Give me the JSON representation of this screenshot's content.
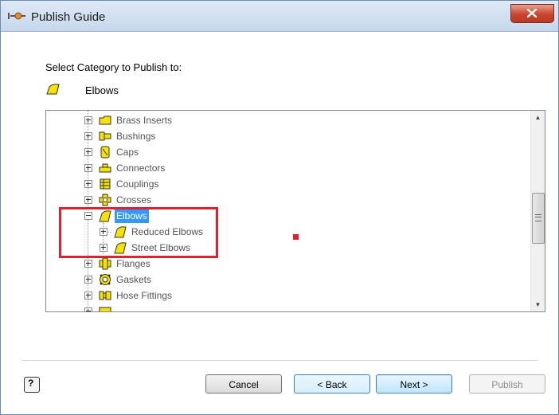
{
  "window": {
    "title": "Publish Guide",
    "close_label": "✕"
  },
  "prompt": "Select Category to Publish to:",
  "selected_category": {
    "label": "Elbows",
    "icon": "elbow-icon"
  },
  "tree": {
    "items": [
      {
        "label": "Brass Inserts",
        "icon": "brass-insert-icon",
        "level": 0,
        "expander": "plus"
      },
      {
        "label": "Bushings",
        "icon": "bushing-icon",
        "level": 0,
        "expander": "plus"
      },
      {
        "label": "Caps",
        "icon": "cap-icon",
        "level": 0,
        "expander": "plus"
      },
      {
        "label": "Connectors",
        "icon": "connector-icon",
        "level": 0,
        "expander": "plus"
      },
      {
        "label": "Couplings",
        "icon": "coupling-icon",
        "level": 0,
        "expander": "plus"
      },
      {
        "label": "Crosses",
        "icon": "cross-icon",
        "level": 0,
        "expander": "plus"
      },
      {
        "label": "Elbows",
        "icon": "elbow-icon",
        "level": 0,
        "expander": "minus",
        "selected": true
      },
      {
        "label": "Reduced Elbows",
        "icon": "elbow-icon",
        "level": 1,
        "expander": "plus"
      },
      {
        "label": "Street Elbows",
        "icon": "elbow-icon",
        "level": 1,
        "expander": "plus"
      },
      {
        "label": "Flanges",
        "icon": "flange-icon",
        "level": 0,
        "expander": "plus"
      },
      {
        "label": "Gaskets",
        "icon": "gasket-icon",
        "level": 0,
        "expander": "plus"
      },
      {
        "label": "Hose Fittings",
        "icon": "hose-fitting-icon",
        "level": 0,
        "expander": "plus"
      }
    ]
  },
  "buttons": {
    "help": "?",
    "cancel": "Cancel",
    "back": "< Back",
    "next": "Next >",
    "publish": "Publish"
  },
  "colors": {
    "selection": "#3399ff",
    "annotation": "#e0202f",
    "icon_fill": "#f5e200"
  }
}
